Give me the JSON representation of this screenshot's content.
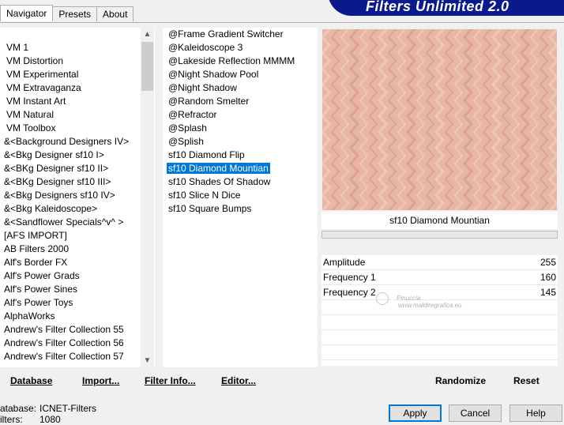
{
  "tabs": [
    "Navigator",
    "Presets",
    "About"
  ],
  "header_title": "Filters Unlimited 2.0",
  "categories": [
    "VM 1",
    "VM Distortion",
    "VM Experimental",
    "VM Extravaganza",
    "VM Instant Art",
    "VM Natural",
    "VM Toolbox",
    "&<Background Designers IV>",
    "&<Bkg Designer sf10 I>",
    "&<BKg Designer sf10 II>",
    "&<BKg Designer sf10 III>",
    "&<Bkg Designers sf10 IV>",
    "&<Bkg Kaleidoscope>",
    "&<Sandflower Specials^v^ >",
    "[AFS IMPORT]",
    "AB Filters 2000",
    "Alf's Border FX",
    "Alf's Power Grads",
    "Alf's Power Sines",
    "Alf's Power Toys",
    "AlphaWorks",
    "Andrew's Filter Collection 55",
    "Andrew's Filter Collection 56",
    "Andrew's Filter Collection 57"
  ],
  "filters": [
    "@Frame Gradient Switcher",
    "@Kaleidoscope 3",
    "@Lakeside Reflection MMMM",
    "@Night Shadow Pool",
    "@Night Shadow",
    "@Random Smelter",
    "@Refractor",
    "@Splash",
    "@Splish",
    "sf10 Diamond Flip",
    "sf10 Diamond Mountian",
    "sf10 Shades Of Shadow",
    "sf10 Slice N Dice",
    "sf10 Square Bumps"
  ],
  "selected_filter_index": 10,
  "selected_filter_name": "sf10 Diamond Mountian",
  "params": [
    {
      "label": "Amplitude",
      "value": "255"
    },
    {
      "label": "Frequency 1",
      "value": "160"
    },
    {
      "label": "Frequency 2",
      "value": "145"
    }
  ],
  "toolbar": {
    "database": "Database",
    "import": "Import...",
    "filter_info": "Filter Info...",
    "editor": "Editor...",
    "randomize": "Randomize",
    "reset": "Reset"
  },
  "status": {
    "database_label": "atabase:",
    "database_value": "ICNET-Filters",
    "filters_label": "ilters:",
    "filters_value": "1080"
  },
  "buttons": {
    "apply": "Apply",
    "cancel": "Cancel",
    "help": "Help"
  },
  "watermark": {
    "line1": "Pinuccia",
    "line2": "www.maldiregrafica.eu"
  },
  "colors": {
    "accent": "#0078d7",
    "banner": "#0a1a8c",
    "preview_base": "#e6b3a3"
  }
}
